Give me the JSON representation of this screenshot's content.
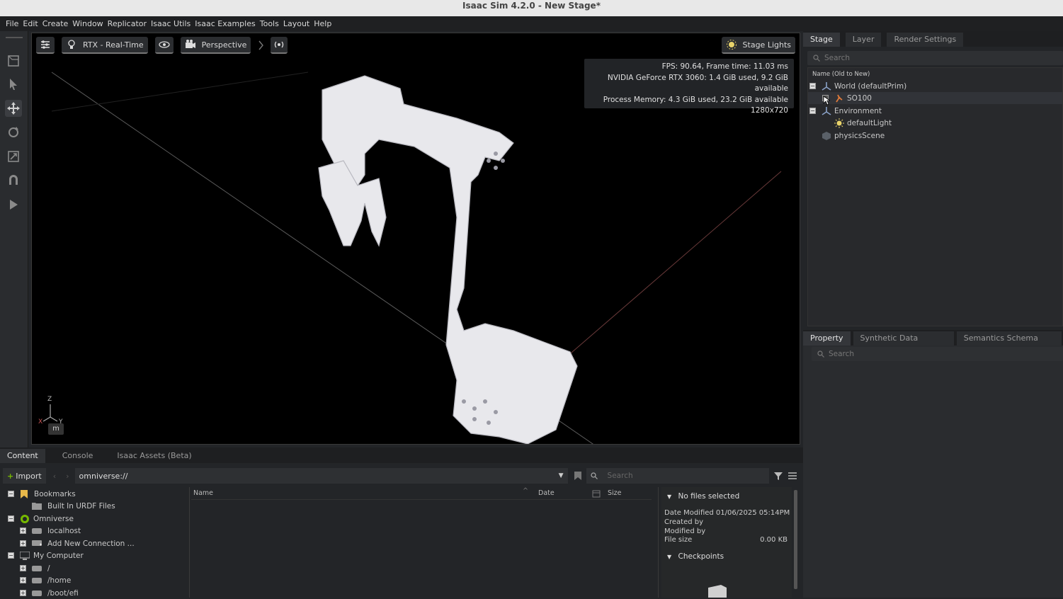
{
  "window": {
    "title": "Isaac Sim 4.2.0 - New Stage*"
  },
  "menu": [
    "File",
    "Edit",
    "Create",
    "Window",
    "Replicator",
    "Isaac Utils",
    "Isaac Examples",
    "Tools",
    "Layout",
    "Help"
  ],
  "viewport": {
    "renderer_label": "RTX - Real-Time",
    "camera_label": "Perspective",
    "stage_lights_label": "Stage Lights",
    "stats": {
      "fps": "FPS: 90.64, Frame time: 11.03 ms",
      "gpu": "NVIDIA GeForce RTX 3060: 1.4 GiB used, 9.2 GiB available",
      "process_memory": "Process Memory: 4.3 GiB used, 23.2 GiB available",
      "resolution": "1280x720"
    },
    "axis_labels": {
      "z": "Z",
      "x": "X",
      "y": "Y"
    },
    "unit_badge": "m"
  },
  "stage_panel": {
    "tabs": [
      "Stage",
      "Layer",
      "Render Settings"
    ],
    "search_placeholder": "Search",
    "column_header": "Name (Old to New)",
    "tree": [
      {
        "label": "World (defaultPrim)",
        "icon": "xform-icon"
      },
      {
        "label": "SO100",
        "icon": "robot-icon"
      },
      {
        "label": "Environment",
        "icon": "xform-icon"
      },
      {
        "label": "defaultLight",
        "icon": "light-icon"
      },
      {
        "label": "physicsScene",
        "icon": "physics-scene-icon"
      }
    ]
  },
  "property_panel": {
    "tabs": [
      "Property",
      "Synthetic Data Recorder",
      "Semantics Schema Editor"
    ],
    "search_placeholder": "Search"
  },
  "content": {
    "tabs": [
      "Content",
      "Console",
      "Isaac Assets (Beta)"
    ],
    "import_label": "Import",
    "path": "omniverse://",
    "search_placeholder": "Search",
    "bookmarks_tree": [
      {
        "label": "Bookmarks",
        "level": 0
      },
      {
        "label": "Built In URDF Files",
        "level": 1
      },
      {
        "label": "Omniverse",
        "level": 0
      },
      {
        "label": "localhost",
        "level": 1
      },
      {
        "label": "Add New Connection ...",
        "level": 1
      },
      {
        "label": "My Computer",
        "level": 0
      },
      {
        "label": "/",
        "level": 1
      },
      {
        "label": "/home",
        "level": 1
      },
      {
        "label": "/boot/efi",
        "level": 1
      }
    ],
    "columns": {
      "name": "Name",
      "date": "Date",
      "size": "Size"
    },
    "detail": {
      "header": "No files selected",
      "date_modified": "Date Modified 01/06/2025 05:14PM",
      "created_by": "Created by",
      "modified_by": "Modified by",
      "file_size_label": "File size",
      "file_size_value": "0.00 KB",
      "checkpoints": "Checkpoints"
    }
  },
  "colors": {
    "accent": "#76b900",
    "panel": "#232528",
    "viewport": "#000000"
  }
}
